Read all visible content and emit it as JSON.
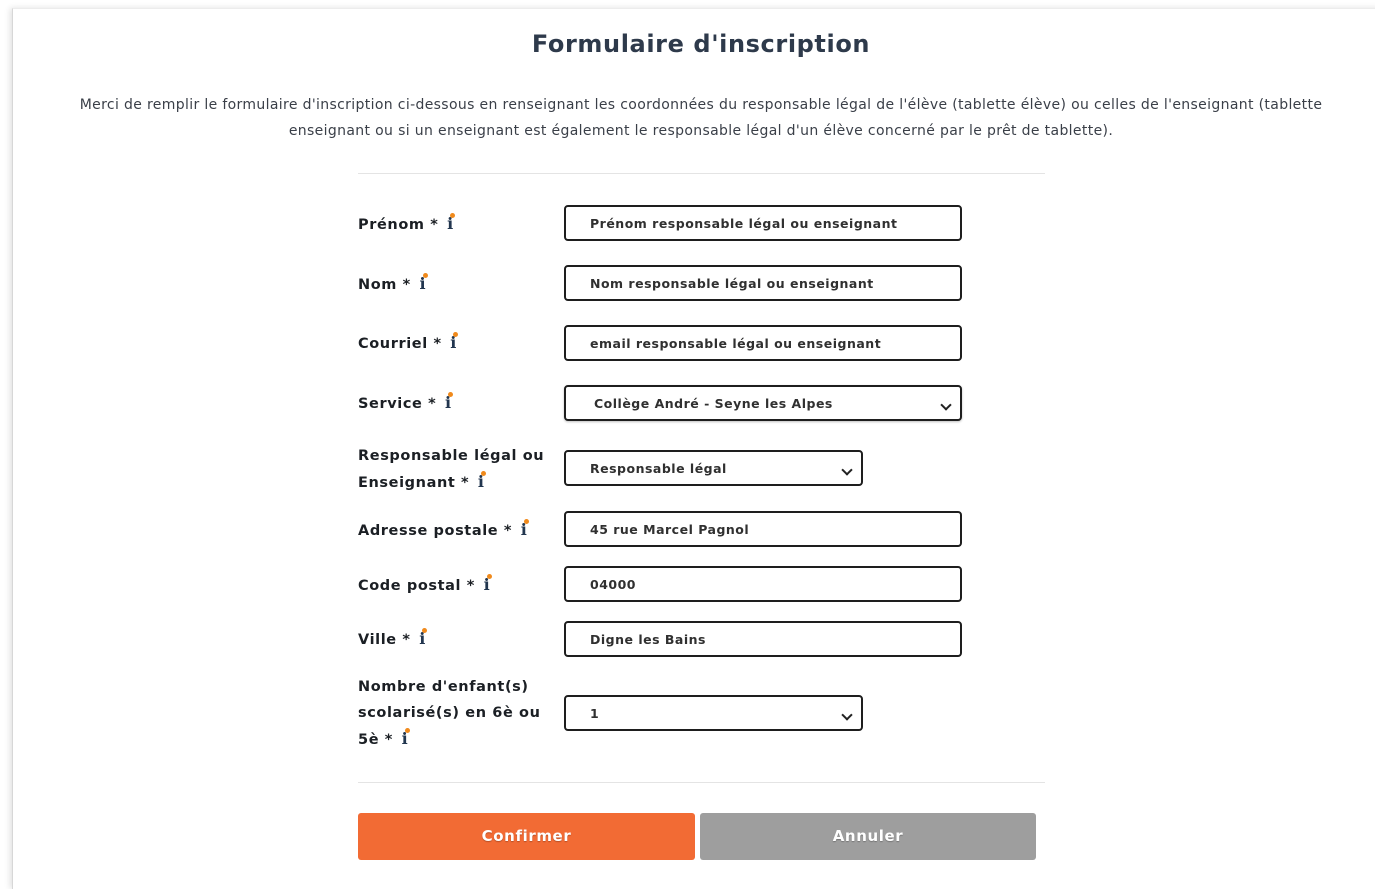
{
  "form": {
    "title": "Formulaire d'inscription",
    "intro_line1": "Merci de remplir le formulaire d'inscription ci-dessous en renseignant les coordonnées du responsable légal de l'élève (tablette élève) ou celles de l'enseignant (tablette",
    "intro_line2": "enseignant ou si un enseignant est également le responsable légal d'un élève concerné par le prêt de tablette).",
    "info_glyph": "i",
    "fields": {
      "prenom": {
        "label": "Prénom *",
        "placeholder": "Prénom responsable légal ou enseignant"
      },
      "nom": {
        "label": "Nom *",
        "placeholder": "Nom responsable légal ou enseignant"
      },
      "courriel": {
        "label": "Courriel *",
        "placeholder": "email responsable légal ou enseignant"
      },
      "service": {
        "label": "Service *",
        "selected": "Collège André - Seyne les Alpes"
      },
      "role": {
        "label_line1": "Responsable légal ou",
        "label_line2": "Enseignant *",
        "selected": "Responsable légal"
      },
      "adresse": {
        "label": "Adresse postale *",
        "value": "45 rue Marcel Pagnol"
      },
      "code_postal": {
        "label": "Code postal *",
        "value": "04000"
      },
      "ville": {
        "label": "Ville *",
        "value": "Digne les Bains"
      },
      "enfants": {
        "label_line1": "Nombre d'enfant(s)",
        "label_line2": "scolarisé(s) en 6è ou",
        "label_line3": "5è *",
        "selected": "1"
      }
    },
    "buttons": {
      "confirm": "Confirmer",
      "cancel": "Annuler"
    },
    "colors": {
      "confirm": "#f26b34",
      "cancel": "#9e9e9e",
      "title": "#2e3a4b",
      "info_dot": "#f08a1c"
    }
  }
}
